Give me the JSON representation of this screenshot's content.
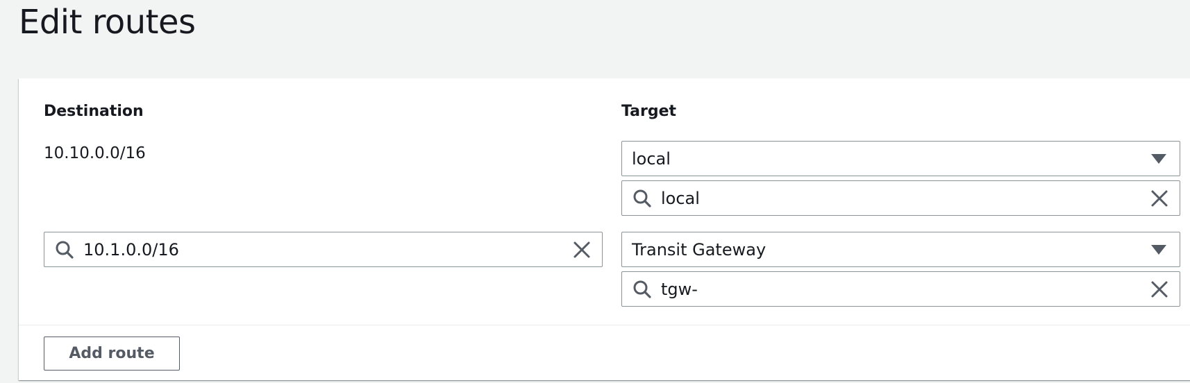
{
  "page": {
    "title": "Edit routes"
  },
  "table": {
    "destination_header": "Destination",
    "target_header": "Target"
  },
  "routes": [
    {
      "destination": "10.10.0.0/16",
      "target_type": "local",
      "target_search": "local"
    },
    {
      "destination": "10.1.0.0/16",
      "target_type": "Transit Gateway",
      "target_search": "tgw-"
    }
  ],
  "actions": {
    "add_route_label": "Add route"
  },
  "colors": {
    "background": "#f2f3f3",
    "panel": "#ffffff",
    "text": "#16191f",
    "border": "#879596",
    "icon": "#545b64"
  },
  "icons": {
    "search": "search-icon",
    "clear": "close-icon",
    "dropdown": "caret-down-icon"
  }
}
